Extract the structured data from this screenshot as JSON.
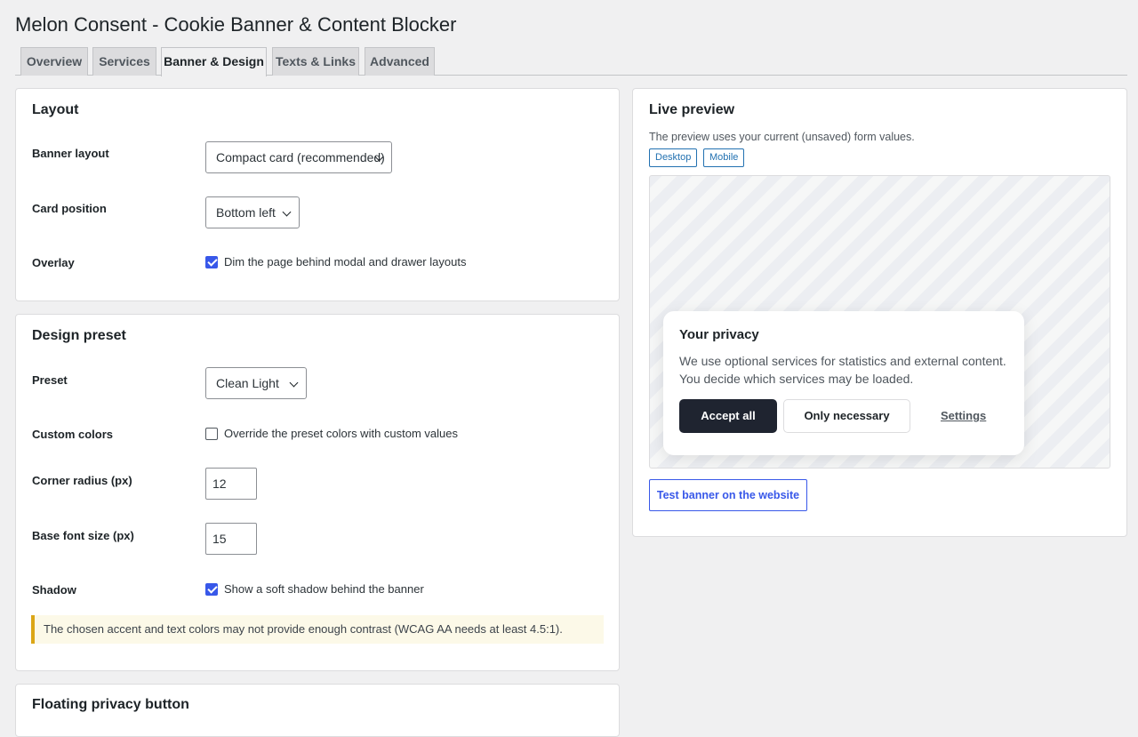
{
  "page": {
    "title": "Melon Consent - Cookie Banner & Content Blocker"
  },
  "tabs": [
    {
      "label": "Overview"
    },
    {
      "label": "Services"
    },
    {
      "label": "Banner & Design",
      "active": true
    },
    {
      "label": "Texts & Links"
    },
    {
      "label": "Advanced"
    }
  ],
  "layout": {
    "title": "Layout",
    "banner_layout_label": "Banner layout",
    "banner_layout_value": "Compact card (recommended)",
    "card_position_label": "Card position",
    "card_position_value": "Bottom left",
    "overlay_label": "Overlay",
    "overlay_checked": true,
    "overlay_text": "Dim the page behind modal and drawer layouts"
  },
  "design": {
    "title": "Design preset",
    "preset_label": "Preset",
    "preset_value": "Clean Light",
    "custom_colors_label": "Custom colors",
    "custom_colors_checked": false,
    "custom_colors_text": "Override the preset colors with custom values",
    "radius_label": "Corner radius (px)",
    "radius_value": "12",
    "font_size_label": "Base font size (px)",
    "font_size_value": "15",
    "shadow_label": "Shadow",
    "shadow_checked": true,
    "shadow_text": "Show a soft shadow behind the banner",
    "notice": "The chosen accent and text colors may not provide enough contrast (WCAG AA needs at least 4.5:1)."
  },
  "floating": {
    "title": "Floating privacy button"
  },
  "preview": {
    "title": "Live preview",
    "description": "The preview uses your current (unsaved) form values.",
    "desktop_label": "Desktop",
    "mobile_label": "Mobile",
    "banner": {
      "title": "Your privacy",
      "text": "We use optional services for statistics and external content. You decide which services may be loaded.",
      "accept_label": "Accept all",
      "necessary_label": "Only necessary",
      "settings_label": "Settings"
    },
    "test_button_label": "Test banner on the website"
  },
  "colors": {
    "accent": "#3858e9",
    "banner_button": "#1f2430",
    "notice_border": "#dba617"
  }
}
